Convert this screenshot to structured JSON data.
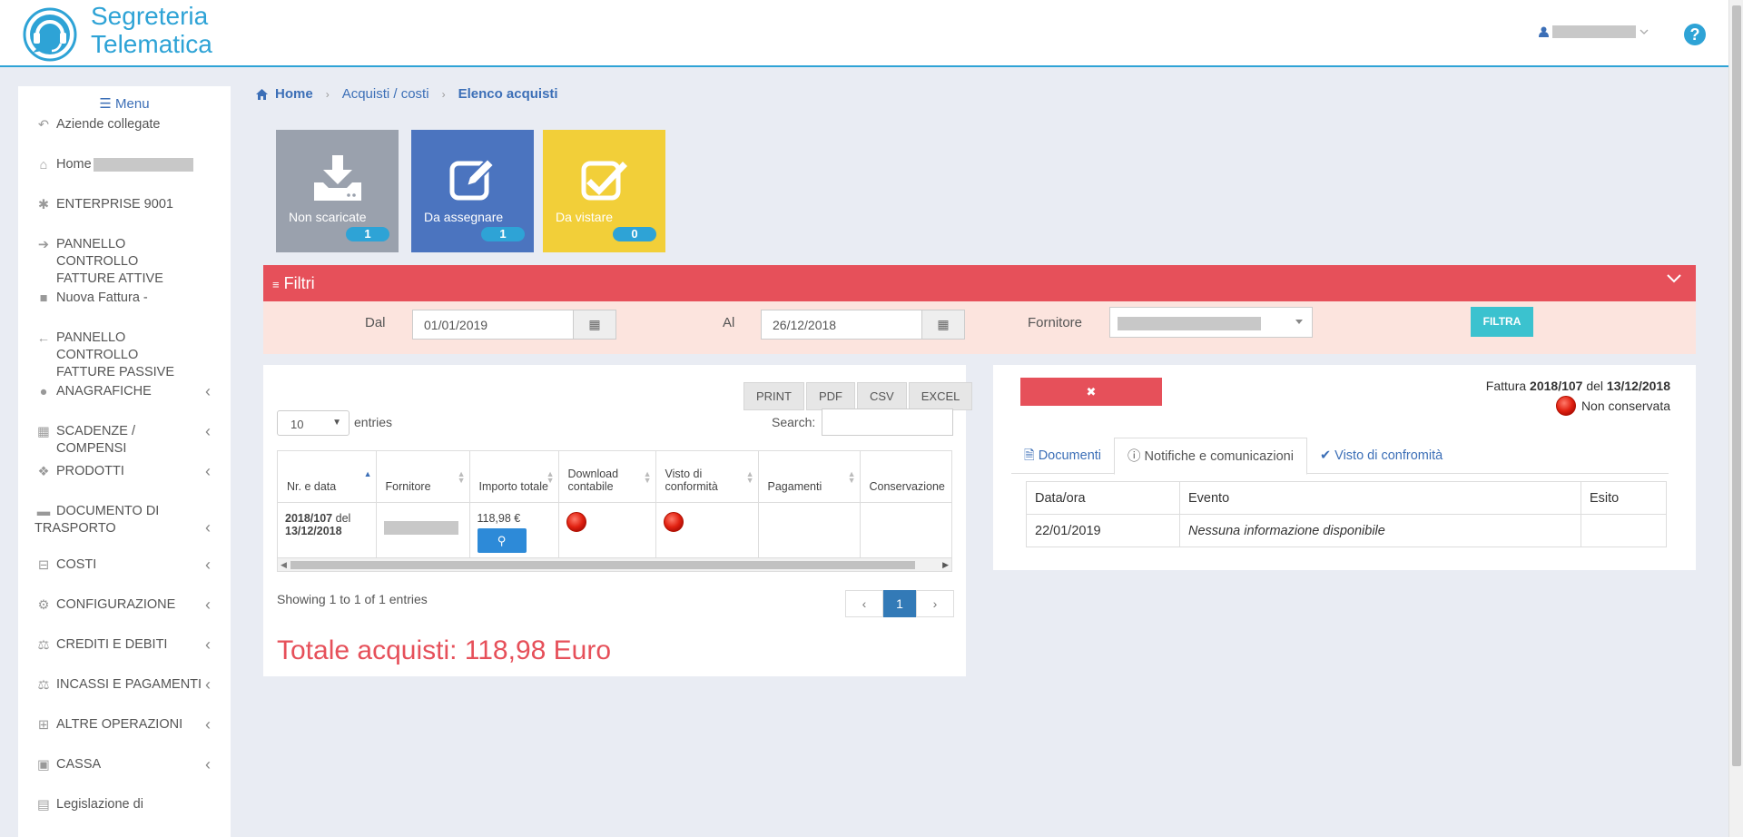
{
  "header": {
    "brand_line1": "Segreteria",
    "brand_line2": "Telematica",
    "help_icon": "?"
  },
  "sidebar": {
    "menu_label": "Menu",
    "items": [
      {
        "label": "Aziende collegate",
        "icon": "reply-arrow-icon"
      },
      {
        "label": "Home",
        "icon": "home-icon"
      },
      {
        "label": "ENTERPRISE 9001",
        "icon": "asterisk-icon"
      },
      {
        "label": "PANNELLO CONTROLLO",
        "label2": "FATTURE ATTIVE",
        "icon": "arrow-right-icon"
      },
      {
        "label": "Nuova Fattura -",
        "icon": "file-icon"
      },
      {
        "label": "PANNELLO CONTROLLO",
        "label2": "FATTURE PASSIVE",
        "icon": "arrow-left-icon"
      },
      {
        "label": "ANAGRAFICHE",
        "icon": "user-icon"
      },
      {
        "label": "SCADENZE / COMPENSI",
        "icon": "calendar-icon"
      },
      {
        "label": "PRODOTTI",
        "icon": "cubes-icon"
      },
      {
        "label": "DOCUMENTO DI",
        "label2": "TRASPORTO",
        "icon": "truck-icon"
      },
      {
        "label": "COSTI",
        "icon": "minus-square-icon"
      },
      {
        "label": "CONFIGURAZIONE",
        "icon": "gear-icon"
      },
      {
        "label": "CREDITI E DEBITI",
        "icon": "balance-scale-icon"
      },
      {
        "label": "INCASSI E PAGAMENTI",
        "icon": "balance-scale-icon"
      },
      {
        "label": "ALTRE OPERAZIONI",
        "icon": "plus-square-icon"
      },
      {
        "label": "CASSA",
        "icon": "money-icon"
      },
      {
        "label": "Legislazione di",
        "icon": "book-icon"
      }
    ]
  },
  "breadcrumb": {
    "home": "Home",
    "level1": "Acquisti / costi",
    "current": "Elenco acquisti"
  },
  "tiles": [
    {
      "label": "Non scaricate",
      "count": "1",
      "color": "#9aa1ad"
    },
    {
      "label": "Da assegnare",
      "count": "1",
      "color": "#4b74bf"
    },
    {
      "label": "Da vistare",
      "count": "0",
      "color": "#f2cf39"
    }
  ],
  "filters": {
    "title": "Filtri",
    "from_label": "Dal",
    "from_value": "01/01/2019",
    "to_label": "Al",
    "to_value": "26/12/2018",
    "supplier_label": "Fornitore",
    "submit_label": "FILTRA"
  },
  "table_tools": {
    "export_buttons": [
      "PRINT",
      "PDF",
      "CSV",
      "EXCEL"
    ],
    "entries_value": "10",
    "entries_label": "entries",
    "search_label": "Search:"
  },
  "table": {
    "columns": [
      "Nr. e data",
      "Fornitore",
      "Importo totale",
      "Download contabile",
      "Visto di conformità",
      "Pagamenti",
      "Conservazione"
    ],
    "rows": [
      {
        "nr": "2018/107",
        "del": "del",
        "date": "13/12/2018",
        "amount": "118,98 €"
      }
    ]
  },
  "table_footer": {
    "showing": "Showing 1 to 1 of 1 entries",
    "pages": [
      "‹",
      "1",
      "›"
    ],
    "total": "Totale acquisti: 118,98 Euro"
  },
  "detail": {
    "invoice_prefix": "Fattura",
    "invoice_number": "2018/107",
    "invoice_del": "del",
    "invoice_date": "13/12/2018",
    "status": "Non conservata",
    "tabs": [
      "Documenti",
      "Notifiche e comunicazioni",
      "Visto di confromità"
    ],
    "notif_columns": [
      "Data/ora",
      "Evento",
      "Esito"
    ],
    "notif_rows": [
      {
        "date": "22/01/2019",
        "event": "Nessuna informazione disponibile",
        "result": ""
      }
    ]
  }
}
